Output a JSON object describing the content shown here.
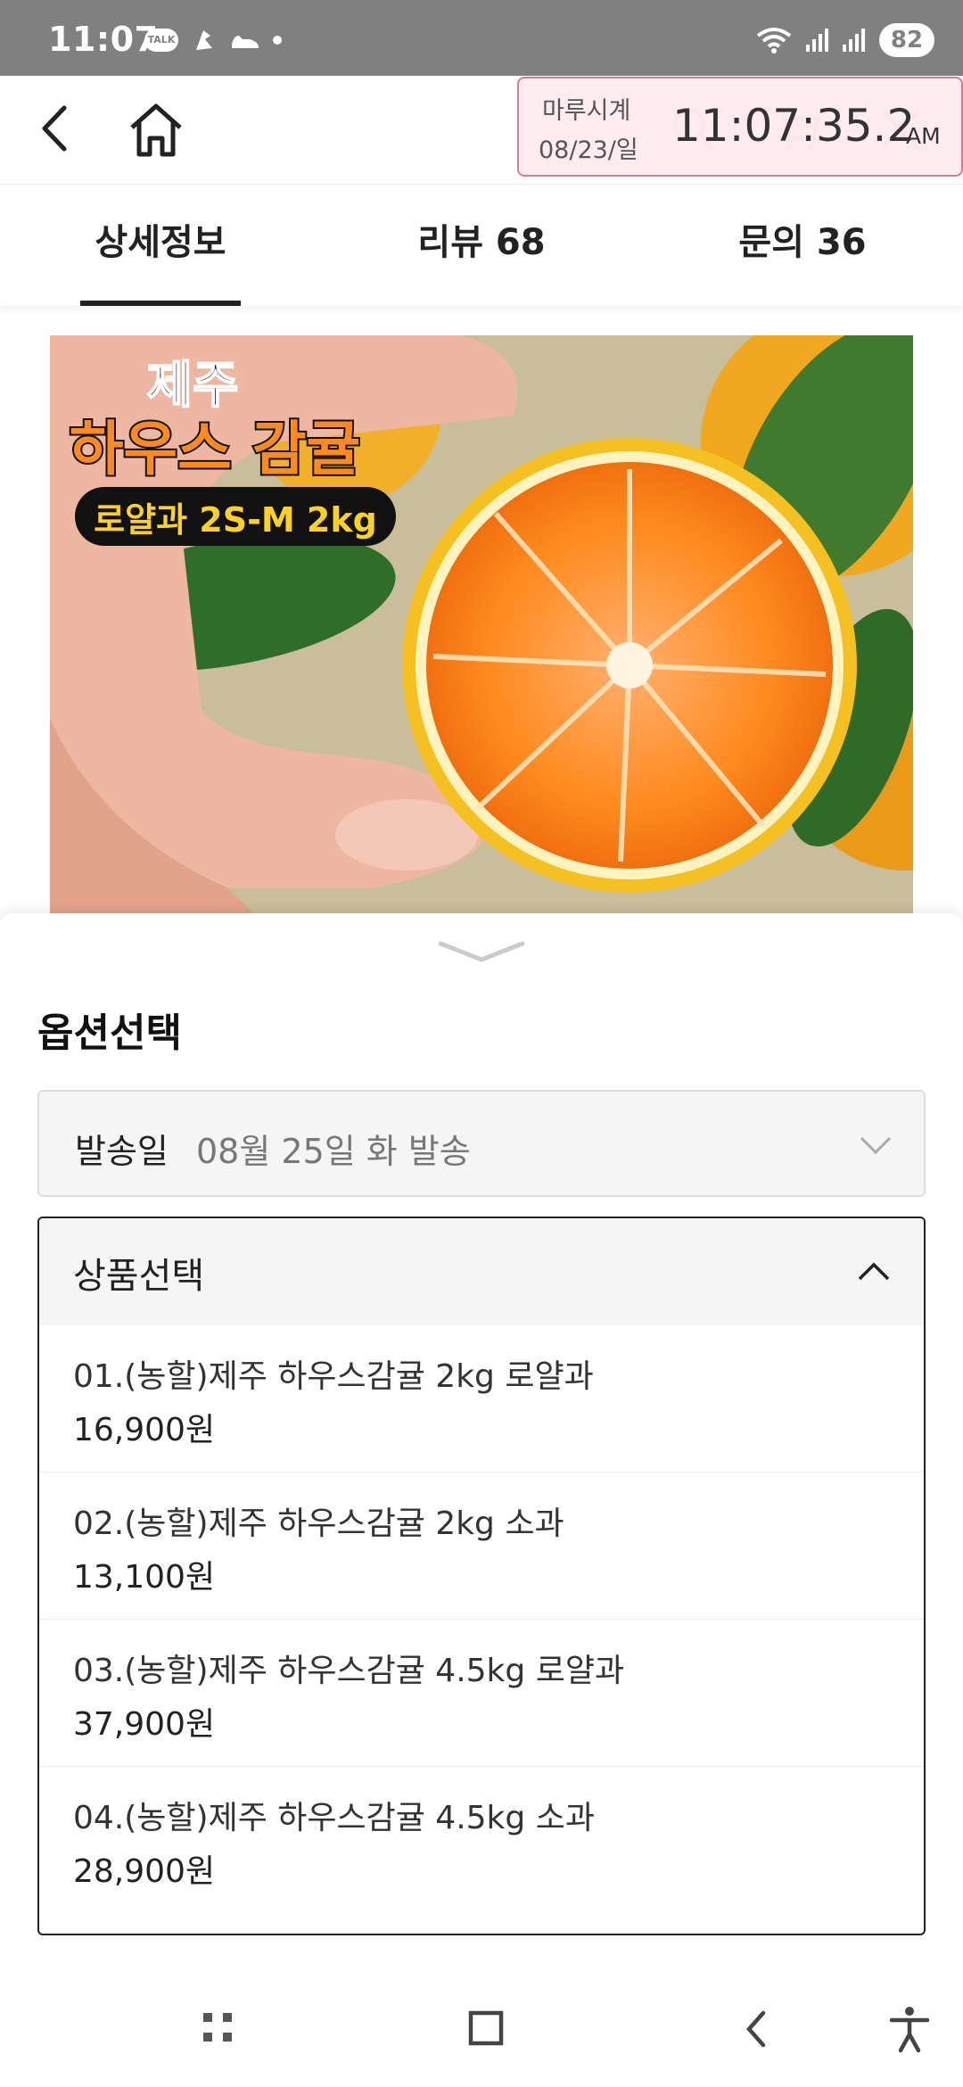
{
  "status_bar": {
    "time": "11:07",
    "talk_badge": "TALK",
    "battery": "82"
  },
  "clock_overlay": {
    "label": "마루시계",
    "date": "08/23/일",
    "time": "11:07:35.2",
    "ampm": "AM"
  },
  "tabs": [
    {
      "label": "상세정보",
      "active": true
    },
    {
      "label": "리뷰 68",
      "active": false
    },
    {
      "label": "문의 36",
      "active": false
    }
  ],
  "product_image": {
    "title_top": "제주",
    "title_main": "하우스 감귤",
    "subtitle": "로얄과 2S-M 2kg"
  },
  "option_sheet": {
    "title": "옵션선택",
    "ship_date": {
      "label": "발송일",
      "value": "08월 25일 화 발송"
    },
    "product_select": {
      "label": "상품선택",
      "options": [
        {
          "name": "01.(농할)제주 하우스감귤 2kg 로얄과",
          "price": "16,900원"
        },
        {
          "name": "02.(농할)제주 하우스감귤 2kg 소과",
          "price": "13,100원"
        },
        {
          "name": "03.(농할)제주 하우스감귤 4.5kg 로얄과",
          "price": "37,900원"
        },
        {
          "name": "04.(농할)제주 하우스감귤 4.5kg 소과",
          "price": "28,900원"
        }
      ]
    }
  },
  "colors": {
    "status_bar": "#808080",
    "overlay_bg": "#ffebf0",
    "overlay_border": "#d87a9a",
    "orange": "#ff8a1e",
    "badge_text": "#ffd21f"
  }
}
